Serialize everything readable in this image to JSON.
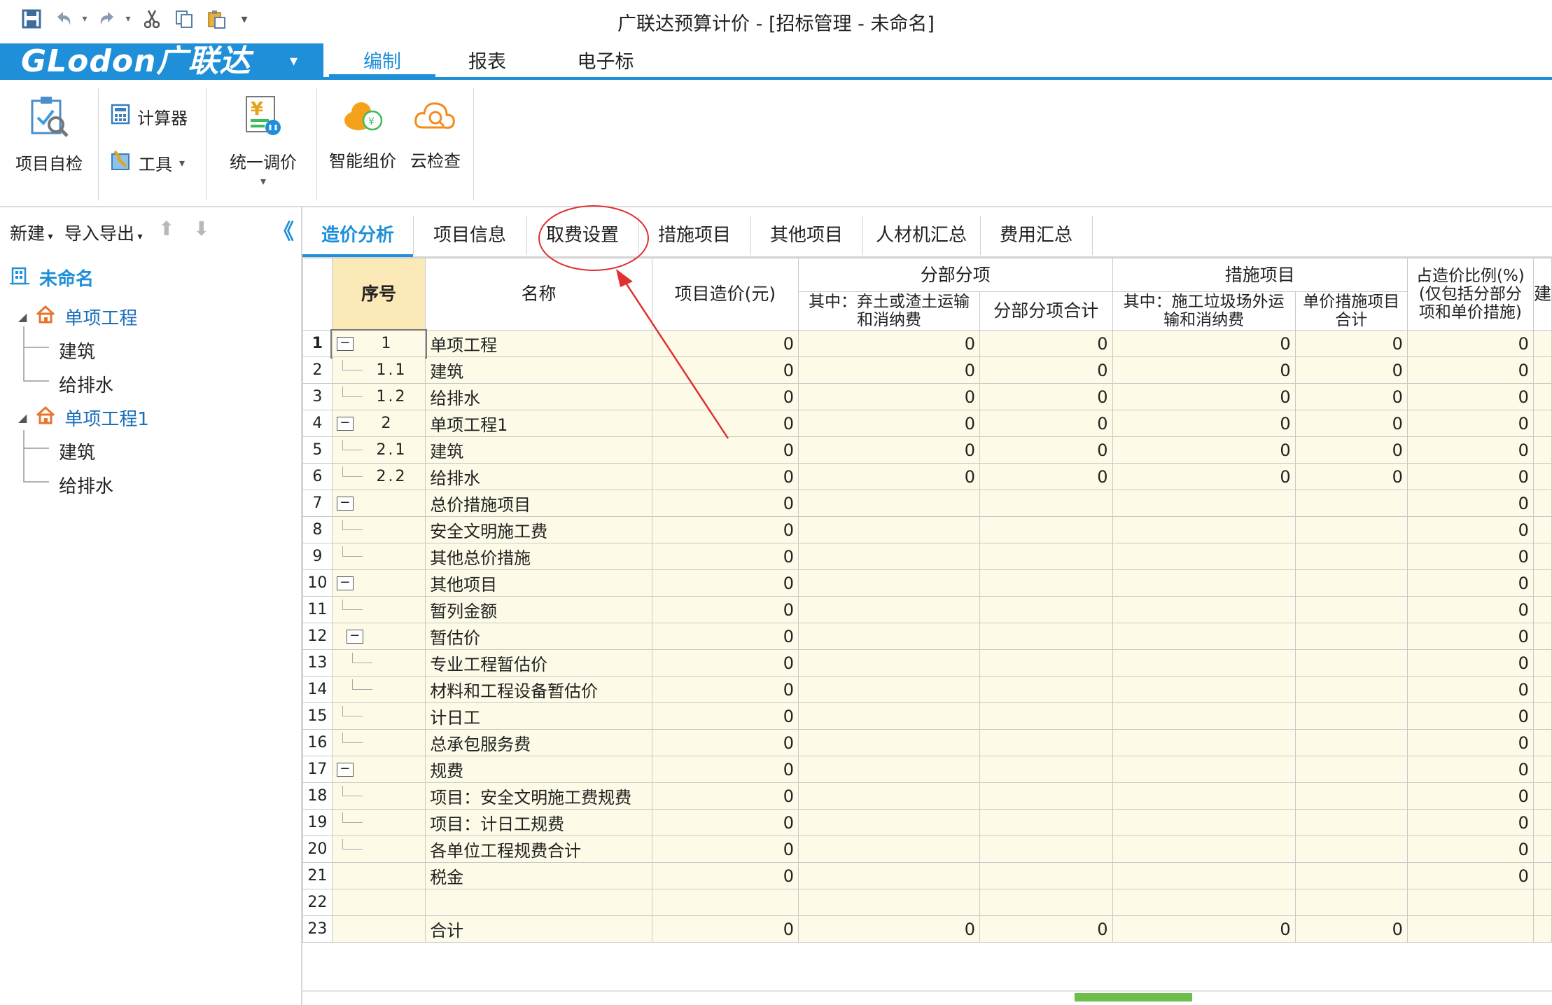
{
  "window": {
    "title": "广联达预算计价 - [招标管理 - 未命名]"
  },
  "quick_access": {
    "icons": [
      "save-icon",
      "undo-icon",
      "redo-icon",
      "cut-icon",
      "copy-icon",
      "paste-icon",
      "customize-icon"
    ]
  },
  "brand": {
    "logo_text": "GLodon广联达",
    "dropdown": "▾"
  },
  "ribbon_tabs": [
    {
      "label": "编制",
      "active": true
    },
    {
      "label": "报表",
      "active": false
    },
    {
      "label": "电子标",
      "active": false
    }
  ],
  "ribbon": {
    "project_check": "项目自检",
    "calculator": "计算器",
    "tools": "工具",
    "unified_price": "统一调价",
    "smart_price": "智能组价",
    "cloud_check": "云检查"
  },
  "left_panel": {
    "new": "新建",
    "import_export": "导入导出",
    "collapse": "《",
    "tree": {
      "root": "未命名",
      "items": [
        {
          "label": "单项工程",
          "children": [
            "建筑",
            "给排水"
          ]
        },
        {
          "label": "单项工程1",
          "children": [
            "建筑",
            "给排水"
          ]
        }
      ]
    }
  },
  "content_tabs": [
    {
      "label": "造价分析",
      "active": true
    },
    {
      "label": "项目信息",
      "active": false
    },
    {
      "label": "取费设置",
      "active": false
    },
    {
      "label": "措施项目",
      "active": false
    },
    {
      "label": "其他项目",
      "active": false
    },
    {
      "label": "人材机汇总",
      "active": false
    },
    {
      "label": "费用汇总",
      "active": false
    }
  ],
  "table": {
    "headers": {
      "seq": "序号",
      "name": "名称",
      "cost": "项目造价(元)",
      "group_fbfx": "分部分项",
      "fbfx_sub1": "其中：弃土或渣土运输和消纳费",
      "fbfx_sub2": "分部分项合计",
      "group_cs": "措施项目",
      "cs_sub1": "其中：施工垃圾场外运输和消纳费",
      "cs_sub2": "单价措施项目合计",
      "ratio": "占造价比例(%)(仅包括分部分项和单价措施)",
      "last": "建"
    },
    "rows": [
      {
        "n": "1",
        "seq": "1",
        "pm": "−",
        "level": 0,
        "name": "单项工程",
        "cost": "0",
        "a": "0",
        "b": "0",
        "c": "0",
        "d": "0",
        "r": "0"
      },
      {
        "n": "2",
        "seq": "1.1",
        "pm": "",
        "level": 1,
        "name": "建筑",
        "cost": "0",
        "a": "0",
        "b": "0",
        "c": "0",
        "d": "0",
        "r": "0"
      },
      {
        "n": "3",
        "seq": "1.2",
        "pm": "",
        "level": 1,
        "name": "给排水",
        "cost": "0",
        "a": "0",
        "b": "0",
        "c": "0",
        "d": "0",
        "r": "0"
      },
      {
        "n": "4",
        "seq": "2",
        "pm": "−",
        "level": 0,
        "name": "单项工程1",
        "cost": "0",
        "a": "0",
        "b": "0",
        "c": "0",
        "d": "0",
        "r": "0"
      },
      {
        "n": "5",
        "seq": "2.1",
        "pm": "",
        "level": 1,
        "name": "建筑",
        "cost": "0",
        "a": "0",
        "b": "0",
        "c": "0",
        "d": "0",
        "r": "0"
      },
      {
        "n": "6",
        "seq": "2.2",
        "pm": "",
        "level": 1,
        "name": "给排水",
        "cost": "0",
        "a": "0",
        "b": "0",
        "c": "0",
        "d": "0",
        "r": "0"
      },
      {
        "n": "7",
        "seq": "",
        "pm": "−",
        "level": 0,
        "name": "总价措施项目",
        "cost": "0",
        "a": "",
        "b": "",
        "c": "",
        "d": "",
        "r": "0"
      },
      {
        "n": "8",
        "seq": "",
        "pm": "",
        "level": 1,
        "name": "安全文明施工费",
        "cost": "0",
        "a": "",
        "b": "",
        "c": "",
        "d": "",
        "r": "0"
      },
      {
        "n": "9",
        "seq": "",
        "pm": "",
        "level": 1,
        "name": "其他总价措施",
        "cost": "0",
        "a": "",
        "b": "",
        "c": "",
        "d": "",
        "r": "0"
      },
      {
        "n": "10",
        "seq": "",
        "pm": "−",
        "level": 0,
        "name": "其他项目",
        "cost": "0",
        "a": "",
        "b": "",
        "c": "",
        "d": "",
        "r": "0"
      },
      {
        "n": "11",
        "seq": "",
        "pm": "",
        "level": 1,
        "name": "暂列金额",
        "cost": "0",
        "a": "",
        "b": "",
        "c": "",
        "d": "",
        "r": "0"
      },
      {
        "n": "12",
        "seq": "",
        "pm": "−",
        "level": 1,
        "name": "暂估价",
        "cost": "0",
        "a": "",
        "b": "",
        "c": "",
        "d": "",
        "r": "0"
      },
      {
        "n": "13",
        "seq": "",
        "pm": "",
        "level": 2,
        "name": "专业工程暂估价",
        "cost": "0",
        "a": "",
        "b": "",
        "c": "",
        "d": "",
        "r": "0"
      },
      {
        "n": "14",
        "seq": "",
        "pm": "",
        "level": 2,
        "name": "材料和工程设备暂估价",
        "cost": "0",
        "a": "",
        "b": "",
        "c": "",
        "d": "",
        "r": "0"
      },
      {
        "n": "15",
        "seq": "",
        "pm": "",
        "level": 1,
        "name": "计日工",
        "cost": "0",
        "a": "",
        "b": "",
        "c": "",
        "d": "",
        "r": "0"
      },
      {
        "n": "16",
        "seq": "",
        "pm": "",
        "level": 1,
        "name": "总承包服务费",
        "cost": "0",
        "a": "",
        "b": "",
        "c": "",
        "d": "",
        "r": "0"
      },
      {
        "n": "17",
        "seq": "",
        "pm": "−",
        "level": 0,
        "name": "规费",
        "cost": "0",
        "a": "",
        "b": "",
        "c": "",
        "d": "",
        "r": "0"
      },
      {
        "n": "18",
        "seq": "",
        "pm": "",
        "level": 1,
        "name": "项目：安全文明施工费规费",
        "cost": "0",
        "a": "",
        "b": "",
        "c": "",
        "d": "",
        "r": "0"
      },
      {
        "n": "19",
        "seq": "",
        "pm": "",
        "level": 1,
        "name": "项目：计日工规费",
        "cost": "0",
        "a": "",
        "b": "",
        "c": "",
        "d": "",
        "r": "0"
      },
      {
        "n": "20",
        "seq": "",
        "pm": "",
        "level": 1,
        "name": "各单位工程规费合计",
        "cost": "0",
        "a": "",
        "b": "",
        "c": "",
        "d": "",
        "r": "0"
      },
      {
        "n": "21",
        "seq": "",
        "pm": "",
        "level": 0,
        "name": "税金",
        "cost": "0",
        "a": "",
        "b": "",
        "c": "",
        "d": "",
        "r": "0"
      },
      {
        "n": "22",
        "seq": "",
        "pm": "",
        "level": 0,
        "name": "",
        "cost": "",
        "a": "",
        "b": "",
        "c": "",
        "d": "",
        "r": ""
      },
      {
        "n": "23",
        "seq": "",
        "pm": "",
        "level": 0,
        "name": "合计",
        "cost": "0",
        "a": "0",
        "b": "0",
        "c": "0",
        "d": "0",
        "r": ""
      }
    ]
  },
  "colors": {
    "accent": "#1e8fd8",
    "cell_bg": "#fdfbe7",
    "annotation": "#e03030"
  }
}
